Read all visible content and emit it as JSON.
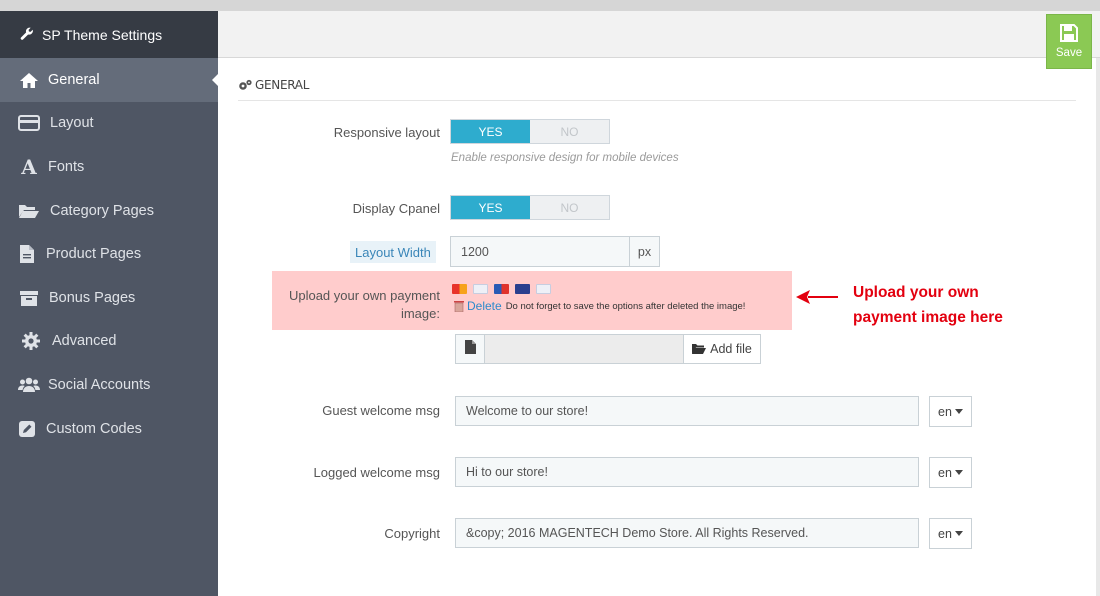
{
  "app": {
    "title": "SP Theme Settings"
  },
  "sidebar": {
    "items": [
      {
        "label": "General",
        "icon": "home-icon",
        "active": true
      },
      {
        "label": "Layout",
        "icon": "layout-icon"
      },
      {
        "label": "Fonts",
        "icon": "font-icon"
      },
      {
        "label": "Category Pages",
        "icon": "folder-open-icon"
      },
      {
        "label": "Product Pages",
        "icon": "file-icon"
      },
      {
        "label": "Bonus Pages",
        "icon": "archive-icon"
      },
      {
        "label": "Advanced",
        "icon": "gear-icon"
      },
      {
        "label": "Social Accounts",
        "icon": "users-icon"
      },
      {
        "label": "Custom Codes",
        "icon": "edit-icon"
      }
    ]
  },
  "toolbar": {
    "save_label": "Save",
    "save_color": "#8bc954"
  },
  "section": {
    "title": "GENERAL"
  },
  "form": {
    "responsive_layout": {
      "label": "Responsive layout",
      "yes": "YES",
      "no": "NO",
      "selected": "YES",
      "help": "Enable responsive design for mobile devices"
    },
    "display_cpanel": {
      "label": "Display Cpanel",
      "yes": "YES",
      "no": "NO",
      "selected": "YES"
    },
    "layout_width": {
      "label": "Layout Width",
      "value": "1200",
      "unit": "px"
    },
    "payment_image": {
      "label_line1": "Upload your own payment",
      "label_line2": "image:",
      "delete_label": "Delete",
      "delete_note": "Do not forget to save the options after deleted the image!",
      "add_file_label": "Add file"
    },
    "guest_welcome": {
      "label": "Guest welcome msg",
      "value": "Welcome to our store!",
      "lang": "en"
    },
    "logged_welcome": {
      "label": "Logged welcome msg",
      "value": "Hi to our store!",
      "lang": "en"
    },
    "copyright": {
      "label": "Copyright",
      "value": "&copy; 2016 MAGENTECH Demo Store. All Rights Reserved.",
      "lang": "en"
    }
  },
  "annotation": {
    "line1": "Upload your own",
    "line2": "payment image here",
    "color": "#e3000f"
  },
  "colors": {
    "accent": "#2eacce",
    "sidebar_bg": "#4f5664",
    "sidebar_title_bg": "#363b44",
    "highlight": "#ffcccc"
  }
}
